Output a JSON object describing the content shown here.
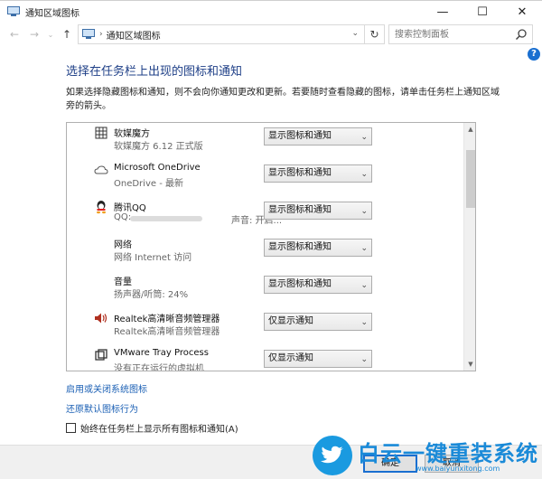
{
  "window": {
    "title": "通知区域图标",
    "controls": {
      "minimize": "—",
      "maximize": "☐",
      "close": "✕"
    }
  },
  "address_bar": {
    "path": "通知区域图标",
    "separator": "›",
    "search_placeholder": "搜索控制面板"
  },
  "main": {
    "heading": "选择在任务栏上出现的图标和通知",
    "description": "如果选择隐藏图标和通知，则不会向你通知更改和更新。若要随时查看隐藏的图标，请单击任务栏上通知区域旁的箭头。"
  },
  "icons": [
    {
      "icon": "grid-icon",
      "name": "软媒魔方",
      "sub": "软媒魔方 6.12 正式版",
      "sub2": "",
      "option": "显示图标和通知"
    },
    {
      "icon": "cloud-icon",
      "name": "Microsoft OneDrive",
      "sub": "OneDrive - 最新",
      "sub2": "",
      "option": "显示图标和通知"
    },
    {
      "icon": "qq-icon",
      "name": "腾讯QQ",
      "sub": "QQ:",
      "sub2": "声音: 开启...",
      "option": "显示图标和通知"
    },
    {
      "icon": "network-icon",
      "name": "网络",
      "sub": "网络 Internet 访问",
      "sub2": "",
      "option": "显示图标和通知"
    },
    {
      "icon": "speaker-icon",
      "name": "音量",
      "sub": "扬声器/听筒: 24%",
      "sub2": "",
      "option": "显示图标和通知"
    },
    {
      "icon": "speaker-icon",
      "name": "Realtek高清晰音频管理器",
      "sub": "Realtek高清晰音频管理器",
      "sub2": "",
      "option": "仅显示通知"
    },
    {
      "icon": "vmware-icon",
      "name": "VMware Tray Process",
      "sub": "没有正在运行的虚拟机",
      "sub2": "",
      "option": "仅显示通知"
    }
  ],
  "links": {
    "system_icons": "启用或关闭系统图标",
    "restore_default": "还原默认图标行为"
  },
  "always_show": {
    "label": "始终在任务栏上显示所有图标和通知(A)",
    "checked": false
  },
  "buttons": {
    "ok": "确定",
    "cancel": "取消"
  },
  "watermark": {
    "brand": "白云一键重装系统",
    "url": "www.baiyunxitong.com"
  },
  "colors": {
    "heading": "#1e3f87",
    "link": "#1a5fb4",
    "accent": "#1a6fd0",
    "brand": "#1a9ae0"
  }
}
